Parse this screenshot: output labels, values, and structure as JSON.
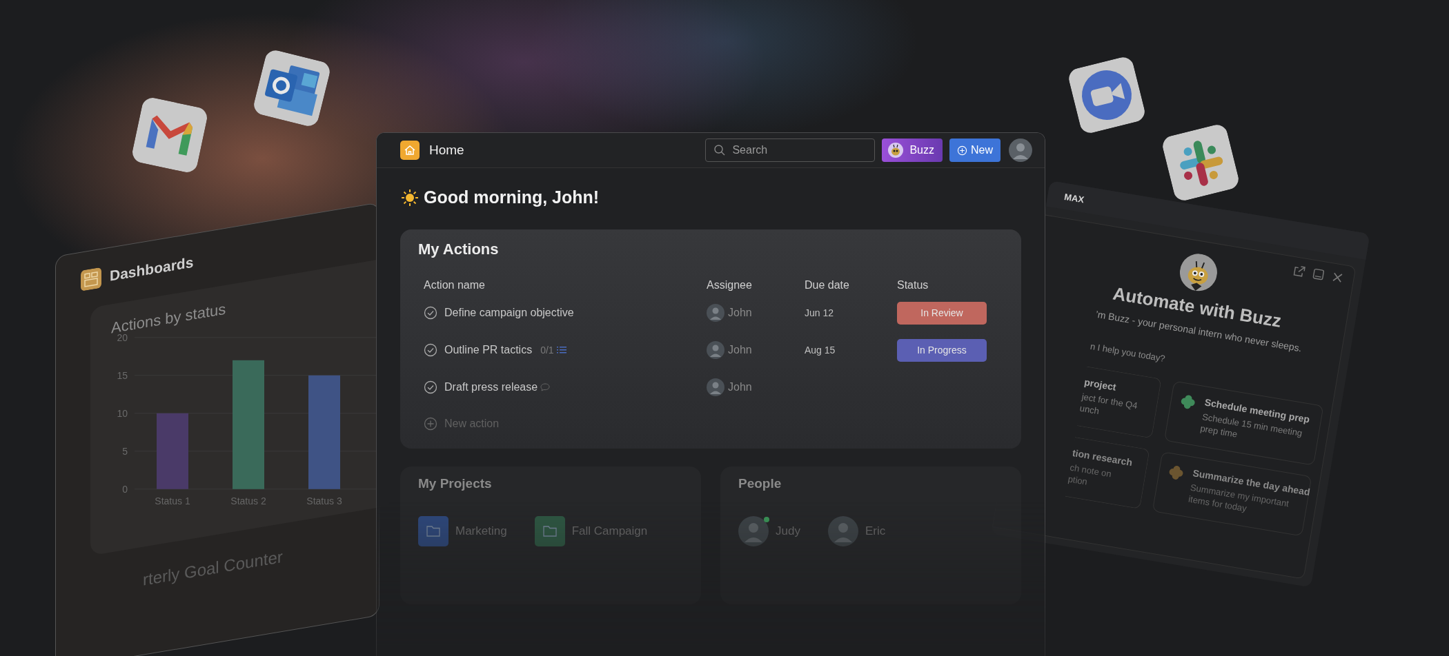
{
  "dashboards_panel": {
    "title": "Dashboards",
    "chart_title": "Actions by status",
    "chart_data": {
      "type": "bar",
      "categories": [
        "Status 1",
        "Status 2",
        "Status 3"
      ],
      "values": [
        10,
        17,
        15
      ],
      "ylim": [
        0,
        20
      ],
      "yticks": [
        0,
        5,
        10,
        15,
        20
      ],
      "grid": true
    },
    "next_widget_title": "rterly Goal Counter"
  },
  "main_window": {
    "title": "Home",
    "search": {
      "placeholder": "Search"
    },
    "buzz_button": "Buzz",
    "new_button": "New",
    "greeting": "Good morning, John!",
    "my_actions": {
      "title": "My Actions",
      "columns": [
        "Action name",
        "Assignee",
        "Due date",
        "Status"
      ],
      "rows": [
        {
          "name": "Define campaign objective",
          "subtasks": null,
          "has_comments": false,
          "assignee": "John",
          "due": "Jun 12",
          "status": {
            "label": "In Review",
            "color": "#c0675e"
          }
        },
        {
          "name": "Outline PR tactics",
          "subtasks": "0/1",
          "has_comments": false,
          "assignee": "John",
          "due": "Aug 15",
          "status": {
            "label": "In Progress",
            "color": "#5b5fb3"
          }
        },
        {
          "name": "Draft press release",
          "subtasks": null,
          "has_comments": true,
          "assignee": "John",
          "due": null,
          "status": null
        }
      ],
      "new_action": "New action"
    },
    "my_projects": {
      "title": "My Projects",
      "items": [
        {
          "name": "Marketing",
          "color": "#2f4a80"
        },
        {
          "name": "Fall Campaign",
          "color": "#2f5a44"
        }
      ]
    },
    "people": {
      "title": "People",
      "items": [
        {
          "name": "Judy",
          "online": true
        },
        {
          "name": "Eric",
          "online": false
        }
      ]
    }
  },
  "buzz_panel": {
    "brand": "MAX",
    "title": "Automate with Buzz",
    "intro": "’m Buzz - your personal intern who never sleeps.",
    "prompt": "n I help you today?",
    "suggestions": [
      {
        "title": "project",
        "lines": [
          "ject for the Q4",
          "unch"
        ]
      },
      {
        "title": "Schedule meeting prep",
        "lines": [
          "Schedule 15 min meeting",
          "prep time"
        ],
        "color": "#3f8a5a"
      },
      {
        "title": "tion research",
        "lines": [
          "ch note on",
          "ption"
        ]
      },
      {
        "title": "Summarize the day ahead",
        "lines": [
          "Summarize my important",
          "items for today"
        ],
        "color": "#6b5530"
      }
    ]
  }
}
